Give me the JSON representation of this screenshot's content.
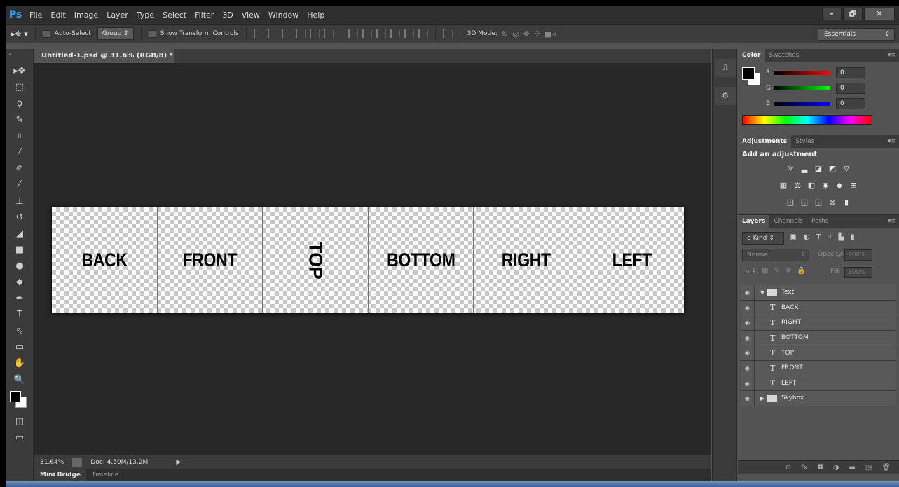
{
  "app": {
    "logo": "Ps",
    "minimize": "–",
    "restore": "🗗",
    "close": "✕"
  },
  "menu": [
    "File",
    "Edit",
    "Image",
    "Layer",
    "Type",
    "Select",
    "Filter",
    "3D",
    "View",
    "Window",
    "Help"
  ],
  "options": {
    "auto_select": "Auto-Select:",
    "group": "Group",
    "show_transform": "Show Transform Controls",
    "mode_3d": "3D Mode:",
    "workspace": "Essentials"
  },
  "document": {
    "tab_title": "Untitled-1.psd @ 31.6% (RGB/8) *",
    "tab_close": "×",
    "faces": [
      "BACK",
      "FRONT",
      "TOP",
      "BOTTOM",
      "RIGHT",
      "LEFT"
    ]
  },
  "status": {
    "zoom": "31.64%",
    "doc_size": "Doc: 4.50M/13.2M",
    "arrow": "▶"
  },
  "mini_tabs": [
    "Mini Bridge",
    "Timeline"
  ],
  "color_panel": {
    "tabs": [
      "Color",
      "Swatches"
    ],
    "sliders": [
      {
        "letter": "R",
        "value": "0",
        "color": "#ff0000"
      },
      {
        "letter": "G",
        "value": "0",
        "color": "#00ff00"
      },
      {
        "letter": "B",
        "value": "0",
        "color": "#0000ff"
      }
    ]
  },
  "adjust_panel": {
    "tabs": [
      "Adjustments",
      "Styles"
    ],
    "title": "Add an adjustment"
  },
  "layers_panel": {
    "tabs": [
      "Layers",
      "Channels",
      "Paths"
    ],
    "kind": "ρ Kind",
    "blend": "Normal",
    "opacity_label": "Opacity:",
    "opacity": "100%",
    "lock_label": "Lock:",
    "fill_label": "Fill:",
    "fill": "100%",
    "layers": [
      {
        "name": "Text",
        "kind": "group-open"
      },
      {
        "name": "BACK",
        "kind": "type"
      },
      {
        "name": "RIGHT",
        "kind": "type"
      },
      {
        "name": "BOTTOM",
        "kind": "type"
      },
      {
        "name": "TOP",
        "kind": "type"
      },
      {
        "name": "FRONT",
        "kind": "type"
      },
      {
        "name": "LEFT",
        "kind": "type"
      },
      {
        "name": "Skybox",
        "kind": "group-closed"
      }
    ]
  },
  "icons": {
    "tools": [
      "move-tool-icon",
      "marquee-icon",
      "lasso-icon",
      "quick-select-icon",
      "crop-icon",
      "eyedropper-icon",
      "healing-brush-icon",
      "brush-icon",
      "clone-stamp-icon",
      "history-brush-icon",
      "eraser-icon",
      "gradient-icon",
      "blur-icon",
      "dodge-icon",
      "pen-icon",
      "type-tool-icon",
      "path-select-icon",
      "rectangle-tool-icon",
      "hand-icon",
      "zoom-icon"
    ],
    "fg_color": "#000000",
    "bg_color": "#ffffff"
  }
}
